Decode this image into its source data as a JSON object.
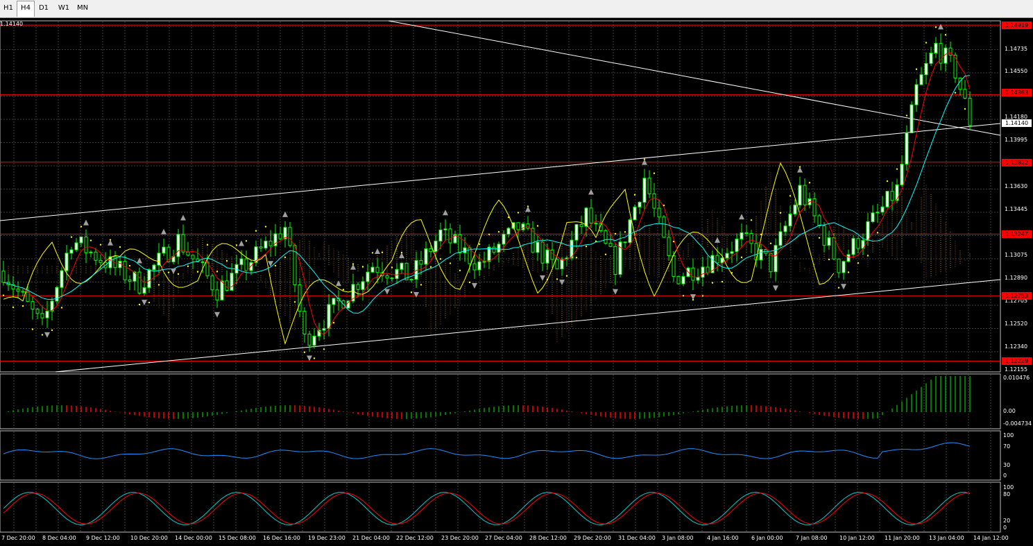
{
  "timeframes": [
    {
      "label": "H1",
      "active": false
    },
    {
      "label": "H4",
      "active": true
    },
    {
      "label": "D1",
      "active": false
    },
    {
      "label": "W1",
      "active": false
    },
    {
      "label": "MN",
      "active": false
    }
  ],
  "top_ticker": "1.14140",
  "current_price": "1.14140",
  "price_axis": [
    "1.14735",
    "1.14550",
    "1.14180",
    "1.13995",
    "1.13630",
    "1.13445",
    "1.13075",
    "1.12890",
    "1.12705",
    "1.12520",
    "1.12340",
    "1.12155"
  ],
  "level_boxes": [
    "1.14919",
    "1.14363",
    "1.13822",
    "1.13247",
    "1.12753",
    "1.12229"
  ],
  "macd_axis": [
    "0.010476",
    "0.00",
    "-0.004734"
  ],
  "rsi_axis": [
    "100",
    "70",
    "30",
    "0"
  ],
  "stoch_axis": [
    "100",
    "80",
    "20",
    "0"
  ],
  "time_axis": [
    "7 Dec 20:00",
    "8 Dec 04:00",
    "9 Dec 12:00",
    "10 Dec 20:00",
    "14 Dec 00:00",
    "15 Dec 08:00",
    "16 Dec 16:00",
    "19 Dec 23:00",
    "21 Dec 04:00",
    "22 Dec 12:00",
    "23 Dec 20:00",
    "27 Dec 04:00",
    "28 Dec 12:00",
    "29 Dec 20:00",
    "31 Dec 04:00",
    "3 Jan 08:00",
    "4 Jan 16:00",
    "6 Jan 00:00",
    "7 Jan 08:00",
    "10 Jan 12:00",
    "11 Jan 20:00",
    "13 Jan 04:00",
    "14 Jan 12:00"
  ],
  "colors": {
    "bull": "#00ff00",
    "bear": "#000000",
    "level": "#ff0000",
    "grid": "#404040",
    "tenkan": "#ff0000",
    "kijun": "#00ffff",
    "yellow": "#ffff00",
    "macd_up": "#00a000",
    "macd_dn": "#ff0000",
    "rsi": "#1e90ff",
    "stoch_main": "#00ced1",
    "stoch_sig": "#ff0000"
  }
}
